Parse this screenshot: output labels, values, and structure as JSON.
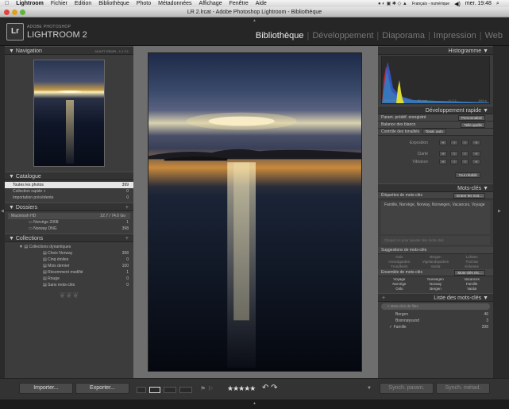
{
  "menubar": {
    "items": [
      "Lightroom",
      "Fichier",
      "Edition",
      "Bibliothèque",
      "Photo",
      "Métadonnées",
      "Affichage",
      "Fenêtre",
      "Aide"
    ],
    "keyboard": "Français - numérique",
    "clock": "mer. 19:48"
  },
  "window": {
    "title": "LR 2.lrcat - Adobe Photoshop Lightroom - Bibliothèque"
  },
  "identity": {
    "brand_small": "ADOBE PHOTOSHOP",
    "brand_big": "LIGHTROOM 2",
    "logo": "Lr",
    "modules": [
      "Bibliothèque",
      "Développement",
      "Diaporama",
      "Impression",
      "Web"
    ],
    "active_module": "Bibliothèque"
  },
  "left": {
    "navigator": {
      "title": "Navigation",
      "zoom_options": "ADAPT  REMPL.  1:1  3:1"
    },
    "catalog": {
      "title": "Catalogue",
      "items": [
        {
          "label": "Toutes les photos",
          "count": "399",
          "selected": true
        },
        {
          "label": "Collection rapide +",
          "count": "0"
        },
        {
          "label": "Importation précédente",
          "count": "0"
        }
      ]
    },
    "folders": {
      "title": "Dossiers",
      "disk": {
        "label": "Macintosh HD",
        "space": "22.7 / 74.0 Go"
      },
      "items": [
        {
          "label": "Norvège 2008",
          "count": "1"
        },
        {
          "label": "Norway DNG",
          "count": "398"
        }
      ]
    },
    "collections": {
      "title": "Collections",
      "group": "Collections dynamiques",
      "items": [
        {
          "label": "Choix Norway",
          "count": "398"
        },
        {
          "label": "Cinq étoiles",
          "count": "0"
        },
        {
          "label": "Mois dernier",
          "count": "100"
        },
        {
          "label": "Récemment modifié",
          "count": "1"
        },
        {
          "label": "Rouge",
          "count": "0"
        },
        {
          "label": "Sans mots-clés",
          "count": "0"
        }
      ]
    },
    "buttons": {
      "import": "Importer...",
      "export": "Exporter..."
    }
  },
  "right": {
    "histogram": {
      "title": "Histogramme",
      "labels": [
        "ISO 200",
        "60 mm",
        "f / 7,1",
        "1/64 s"
      ]
    },
    "quick_develop": {
      "title": "Développement rapide",
      "preset_label": "Param. prédéf. enregistré",
      "preset_value": "Personnalisé",
      "wb_label": "Balance des blancs",
      "wb_value": "Telle quelle",
      "tone_label": "Contrôle des tonalités",
      "tone_auto": "Tonal. auto",
      "exposure": "Exposition",
      "clarity": "Clarté",
      "vibrance": "Vibrance",
      "reset": "Tout rétablir"
    },
    "keywording": {
      "title": "Mots-clés",
      "tags_label": "Étiquettes de mots-clés",
      "tags_value": "Entrer les mot...",
      "tags_text": "Famille, Norvège, Norway, Norwegen, Vacances, Voyage",
      "add_hint": "Cliquez ici pour ajouter des mots-clés",
      "suggestions_title": "Suggestions de mots-clés",
      "suggestions": [
        "Oslo",
        "Bergen",
        "Lofoten",
        "Hovedgarden",
        "Vigelandsparken",
        "Tromsø",
        "Trondheim",
        "Vardø",
        "Kirkenes"
      ],
      "set_label": "Ensemble de mots-clés",
      "set_value": "Mots-clés réc...",
      "set": [
        "Voyage",
        "Norwegen",
        "Vacances",
        "Norvège",
        "Norway",
        "Famille",
        "Oslo",
        "Bergen",
        "Vardø"
      ]
    },
    "keyword_list": {
      "title": "Liste des mots-clés",
      "filter_placeholder": "Mots-clés de filtre",
      "items": [
        {
          "label": "Bergen",
          "count": "46"
        },
        {
          "label": "Brønnøysund",
          "count": "3"
        },
        {
          "label": "Famille",
          "count": "398"
        }
      ]
    },
    "buttons": {
      "sync_settings": "Synch. param.",
      "sync_meta": "Synch. métad."
    }
  },
  "toolbar": {
    "rating_stars": "★★★★★"
  },
  "colors": {
    "panel": "#3c3c3c",
    "center": "#6e6e6e",
    "selected_row": "#e6e6e6"
  }
}
